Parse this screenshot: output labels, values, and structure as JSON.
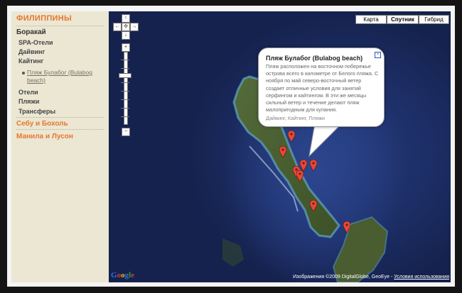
{
  "sidebar": {
    "country": "ФИЛИППИНЫ",
    "region_active": "Боракай",
    "subcategories": [
      "SPA-Отели",
      "Дайвинг",
      "Кайтинг"
    ],
    "active_item": "Пляж Булабог (Bulabog beach)",
    "more_subcategories": [
      "Отели",
      "Пляжи",
      "Трансферы"
    ],
    "other_regions": [
      "Себу и Бохоль",
      "Манила и Лусон"
    ]
  },
  "map": {
    "types": [
      "Карта",
      "Спутник",
      "Гибрид"
    ],
    "active_type": "Спутник",
    "controls": {
      "up": "↑",
      "left": "←",
      "center": "✣",
      "right": "→",
      "down": "↓",
      "zoom_in": "+",
      "zoom_out": "−"
    },
    "popup": {
      "title": "Пляж Булабог (Bulabog beach)",
      "body": "Пляж расположен на восточном побережье острова всего в километре от Белого пляжа. С ноября по май северо-восточный ветер создает отличные условия для занятий серфингом и кайтингом. В эти же месяцы сильный ветер и течение делают пляж малопригодным для купания.",
      "tags": "Дайвинг, Кайтинг, Пляжи",
      "close": "×"
    },
    "logo": "Google",
    "copyright": "Изображения ©2009 DigitalGlobe, GeoEye -",
    "terms": "Условия использования",
    "colors": {
      "accent": "#e8762e",
      "sidebar_bg": "#ebe7d3",
      "pin": "#e24a3b",
      "sea": "#1c2d64"
    }
  }
}
